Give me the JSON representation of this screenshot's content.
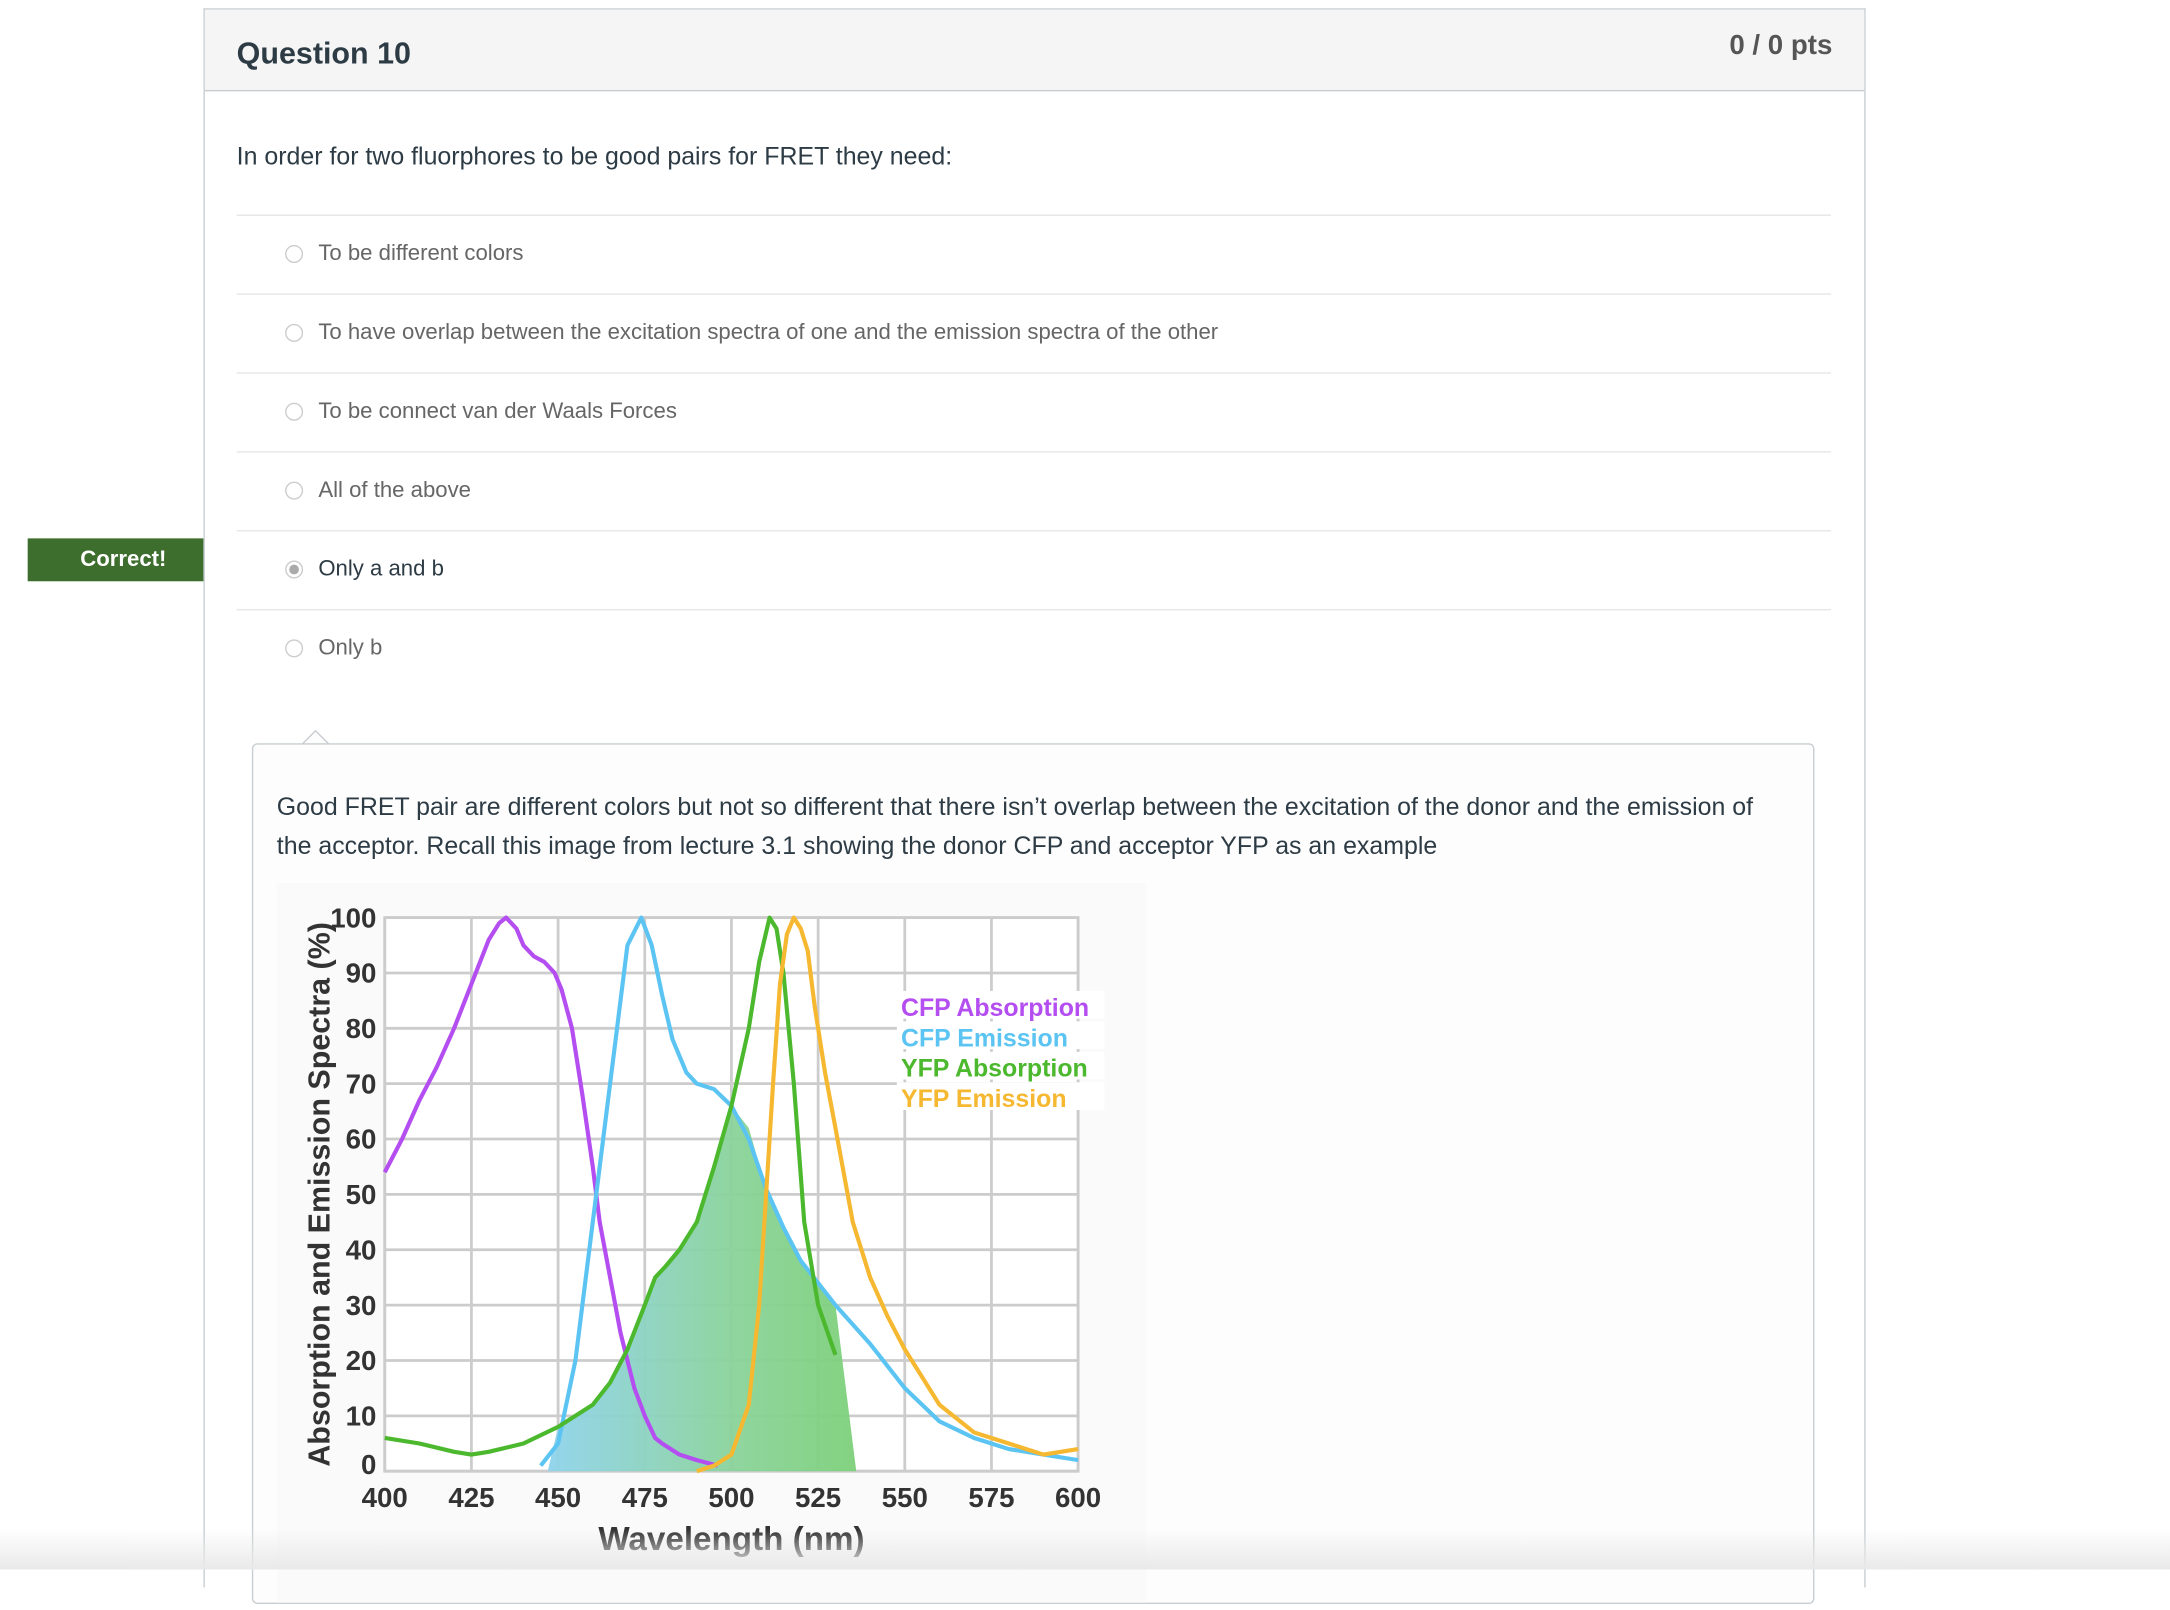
{
  "question": {
    "title": "Question 10",
    "points": "0 / 0 pts",
    "text": "In order for two fluorphores to be good pairs for FRET they need:",
    "answers": [
      {
        "label": "To be different colors",
        "selected": false
      },
      {
        "label": "To have overlap between the excitation spectra of one and the emission spectra of the other",
        "selected": false
      },
      {
        "label": "To be connect van der Waals Forces",
        "selected": false
      },
      {
        "label": "All of the above",
        "selected": false
      },
      {
        "label": "Only a and b",
        "selected": true
      },
      {
        "label": "Only b",
        "selected": false
      }
    ],
    "correct_badge": "Correct!",
    "comment": "Good FRET pair are different colors but not so different that there isn’t overlap between the excitation of the donor and the emission of the acceptor. Recall this image from lecture 3.1 showing the donor CFP and acceptor YFP as an example"
  },
  "colors": {
    "badge": "#3e6e2e",
    "cfp_abs": "#b44ef0",
    "cfp_em": "#5bc4f2",
    "yfp_abs": "#4cb82e",
    "yfp_em": "#f5b830"
  },
  "chart_data": {
    "type": "line",
    "xlabel": "Wavelength (nm)",
    "ylabel": "Absorption and Emission Spectra (%)",
    "xlim": [
      400,
      600
    ],
    "ylim": [
      0,
      100
    ],
    "xticks": [
      "400",
      "425",
      "450",
      "475",
      "500",
      "525",
      "550",
      "575",
      "600"
    ],
    "yticks": [
      "0",
      "10",
      "20",
      "30",
      "40",
      "50",
      "60",
      "70",
      "80",
      "90",
      "100"
    ],
    "grid": true,
    "legend_position": "top-right",
    "series": [
      {
        "name": "CFP Absorption",
        "color": "#b44ef0",
        "points": [
          [
            400,
            54
          ],
          [
            405,
            60
          ],
          [
            410,
            67
          ],
          [
            415,
            73
          ],
          [
            420,
            80
          ],
          [
            425,
            88
          ],
          [
            430,
            96
          ],
          [
            433,
            99
          ],
          [
            435,
            100
          ],
          [
            438,
            98
          ],
          [
            440,
            95
          ],
          [
            443,
            93
          ],
          [
            446,
            92
          ],
          [
            449,
            90
          ],
          [
            451,
            87
          ],
          [
            454,
            80
          ],
          [
            457,
            68
          ],
          [
            460,
            55
          ],
          [
            462,
            45
          ],
          [
            465,
            35
          ],
          [
            468,
            25
          ],
          [
            470,
            20
          ],
          [
            472,
            15
          ],
          [
            475,
            10
          ],
          [
            478,
            6
          ],
          [
            480,
            5
          ],
          [
            485,
            3
          ],
          [
            490,
            2
          ],
          [
            496,
            1
          ]
        ]
      },
      {
        "name": "CFP Emission",
        "color": "#5bc4f2",
        "points": [
          [
            445,
            1
          ],
          [
            450,
            5
          ],
          [
            455,
            20
          ],
          [
            460,
            45
          ],
          [
            465,
            70
          ],
          [
            468,
            85
          ],
          [
            470,
            95
          ],
          [
            474,
            100
          ],
          [
            477,
            95
          ],
          [
            480,
            86
          ],
          [
            483,
            78
          ],
          [
            487,
            72
          ],
          [
            490,
            70
          ],
          [
            495,
            69
          ],
          [
            500,
            66
          ],
          [
            505,
            60
          ],
          [
            510,
            51
          ],
          [
            515,
            44
          ],
          [
            520,
            38
          ],
          [
            525,
            34
          ],
          [
            530,
            30
          ],
          [
            540,
            23
          ],
          [
            550,
            15
          ],
          [
            560,
            9
          ],
          [
            570,
            6
          ],
          [
            580,
            4
          ],
          [
            590,
            3
          ],
          [
            600,
            2
          ]
        ]
      },
      {
        "name": "YFP Absorption",
        "color": "#4cb82e",
        "points": [
          [
            400,
            6
          ],
          [
            410,
            5
          ],
          [
            420,
            3.5
          ],
          [
            425,
            3
          ],
          [
            430,
            3.5
          ],
          [
            440,
            5
          ],
          [
            450,
            8
          ],
          [
            460,
            12
          ],
          [
            465,
            16
          ],
          [
            470,
            22
          ],
          [
            475,
            30
          ],
          [
            478,
            35
          ],
          [
            481,
            37
          ],
          [
            485,
            40
          ],
          [
            490,
            45
          ],
          [
            495,
            55
          ],
          [
            500,
            66
          ],
          [
            505,
            80
          ],
          [
            508,
            92
          ],
          [
            511,
            100
          ],
          [
            513,
            98
          ],
          [
            515,
            90
          ],
          [
            518,
            70
          ],
          [
            521,
            45
          ],
          [
            525,
            30
          ],
          [
            530,
            21
          ]
        ]
      },
      {
        "name": "YFP Emission",
        "color": "#f5b830",
        "points": [
          [
            490,
            0
          ],
          [
            495,
            1
          ],
          [
            500,
            3
          ],
          [
            505,
            12
          ],
          [
            508,
            30
          ],
          [
            510,
            50
          ],
          [
            512,
            70
          ],
          [
            514,
            88
          ],
          [
            516,
            97
          ],
          [
            518,
            100
          ],
          [
            520,
            98
          ],
          [
            522,
            94
          ],
          [
            524,
            84
          ],
          [
            527,
            72
          ],
          [
            530,
            62
          ],
          [
            535,
            45
          ],
          [
            540,
            35
          ],
          [
            545,
            28
          ],
          [
            550,
            22
          ],
          [
            555,
            17
          ],
          [
            560,
            12
          ],
          [
            570,
            7
          ],
          [
            580,
            5
          ],
          [
            590,
            3
          ],
          [
            600,
            4
          ]
        ]
      }
    ],
    "overlap_fill": [
      [
        447,
        0
      ],
      [
        450,
        8
      ],
      [
        460,
        12
      ],
      [
        465,
        16
      ],
      [
        470,
        22
      ],
      [
        475,
        30
      ],
      [
        478,
        35
      ],
      [
        481,
        37
      ],
      [
        485,
        40
      ],
      [
        490,
        45
      ],
      [
        495,
        55
      ],
      [
        500,
        66
      ],
      [
        505,
        62
      ],
      [
        510,
        51
      ],
      [
        515,
        44
      ],
      [
        520,
        38
      ],
      [
        525,
        34
      ],
      [
        530,
        30
      ],
      [
        536,
        0
      ]
    ]
  }
}
